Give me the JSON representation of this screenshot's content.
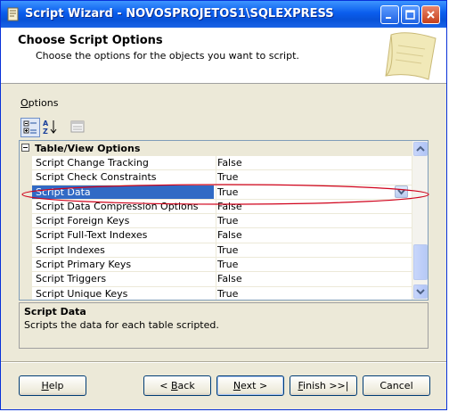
{
  "window": {
    "title": "Script Wizard - NOVOSPROJETOS1\\SQLEXPRESS"
  },
  "header": {
    "title": "Choose Script Options",
    "subtitle": "Choose the options for the objects you want to script."
  },
  "options_label": {
    "accel": "O",
    "rest": "ptions"
  },
  "grid": {
    "category": "Table/View Options",
    "rows": [
      {
        "name": "Script Change Tracking",
        "value": "False"
      },
      {
        "name": "Script Check Constraints",
        "value": "True"
      },
      {
        "name": "Script Data",
        "value": "True"
      },
      {
        "name": "Script Data Compression Options",
        "value": "False"
      },
      {
        "name": "Script Foreign Keys",
        "value": "True"
      },
      {
        "name": "Script Full-Text Indexes",
        "value": "False"
      },
      {
        "name": "Script Indexes",
        "value": "True"
      },
      {
        "name": "Script Primary Keys",
        "value": "True"
      },
      {
        "name": "Script Triggers",
        "value": "False"
      },
      {
        "name": "Script Unique Keys",
        "value": "True"
      }
    ],
    "selected_index": 2
  },
  "description": {
    "title": "Script Data",
    "text": "Scripts the data for each table scripted."
  },
  "buttons": {
    "help": {
      "accel": "H",
      "rest": "elp"
    },
    "back": {
      "pre": "< ",
      "accel": "B",
      "rest": "ack"
    },
    "next": {
      "accel": "N",
      "rest": "ext >"
    },
    "finish": {
      "accel": "F",
      "rest": "inish >>|"
    },
    "cancel": "Cancel"
  },
  "colors": {
    "selection": "#316ac5",
    "titlebar": "#0a5ded",
    "highlight_ellipse": "#d0021b"
  }
}
